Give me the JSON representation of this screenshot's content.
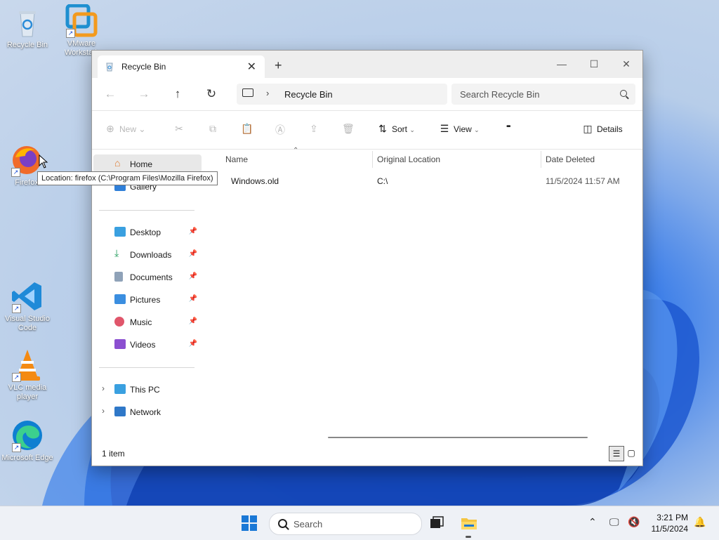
{
  "desktop": {
    "icons": [
      {
        "label": "Recycle Bin"
      },
      {
        "label": "VMware Workstation"
      },
      {
        "label": "Firefox"
      },
      {
        "label": "Visual Studio Code"
      },
      {
        "label": "VLC media player"
      },
      {
        "label": "Microsoft Edge"
      }
    ],
    "tooltip": "Location: firefox (C:\\Program Files\\Mozilla Firefox)"
  },
  "window": {
    "tab_title": "Recycle Bin",
    "address": {
      "crumb": "Recycle Bin"
    },
    "search_placeholder": "Search Recycle Bin",
    "commands": {
      "new": "New",
      "sort": "Sort",
      "view": "View",
      "more": "•••",
      "details": "Details"
    },
    "nav": {
      "home": "Home",
      "gallery": "Gallery",
      "quick_access": [
        {
          "label": "Desktop"
        },
        {
          "label": "Downloads"
        },
        {
          "label": "Documents"
        },
        {
          "label": "Pictures"
        },
        {
          "label": "Music"
        },
        {
          "label": "Videos"
        }
      ],
      "this_pc": "This PC",
      "network": "Network"
    },
    "columns": {
      "name": "Name",
      "original_location": "Original Location",
      "date_deleted": "Date Deleted"
    },
    "rows": [
      {
        "name": "Windows.old",
        "original_location": "C:\\",
        "date_deleted": "11/5/2024 11:57 AM"
      }
    ],
    "status": "1 item"
  },
  "taskbar": {
    "search_placeholder": "Search",
    "time": "3:21 PM",
    "date": "11/5/2024"
  },
  "colors": {
    "accent": "#0067c0",
    "taskbar": "#eef1f6",
    "selected_nav": "#e8e8e8"
  }
}
